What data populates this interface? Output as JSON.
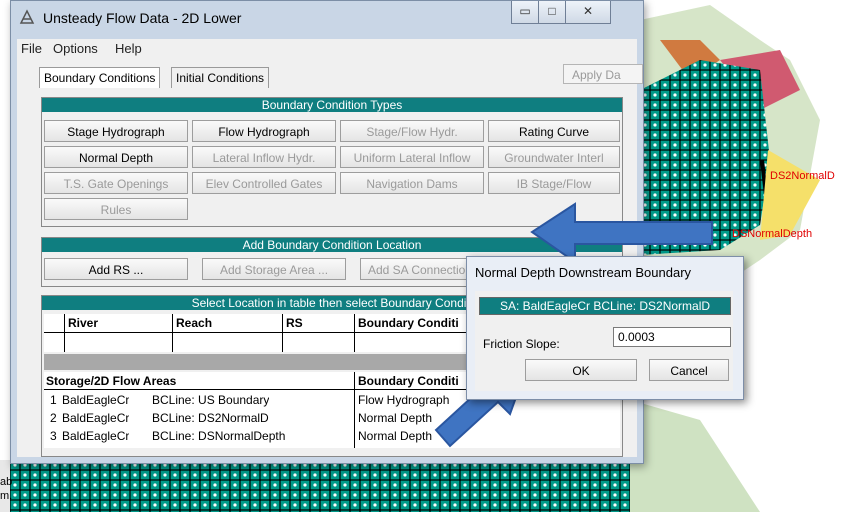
{
  "window": {
    "title": "Unsteady Flow Data - 2D Lower",
    "min_glyph": "▭",
    "max_glyph": "□",
    "close_glyph": "✕"
  },
  "menu": {
    "file": "File",
    "options": "Options",
    "help": "Help"
  },
  "tabs": {
    "boundary": "Boundary Conditions",
    "initial": "Initial Conditions"
  },
  "apply_label": "Apply Da",
  "bc_types": {
    "header": "Boundary Condition Types",
    "stage_hydrograph": "Stage Hydrograph",
    "flow_hydrograph": "Flow Hydrograph",
    "stage_flow_hydr": "Stage/Flow Hydr.",
    "rating_curve": "Rating Curve",
    "normal_depth": "Normal Depth",
    "lateral_inflow": "Lateral Inflow Hydr.",
    "uniform_lateral": "Uniform Lateral Inflow",
    "groundwater": "Groundwater Interl",
    "ts_gate": "T.S. Gate Openings",
    "elev_gates": "Elev Controlled Gates",
    "nav_dams": "Navigation Dams",
    "ib_stage_flow": "IB Stage/Flow",
    "rules": "Rules"
  },
  "add_location": {
    "header": "Add Boundary Condition Location",
    "add_rs": "Add RS ...",
    "add_storage": "Add Storage Area ...",
    "add_sa_conn": "Add SA Connection"
  },
  "table": {
    "header": "Select Location in table then select Boundary Conditi",
    "cols": {
      "river": "River",
      "reach": "Reach",
      "rs": "RS",
      "bc": "Boundary Conditi"
    },
    "sa_section": "Storage/2D Flow Areas",
    "sa_bc_col": "Boundary Conditi",
    "rows": [
      {
        "num": "1",
        "area": "BaldEagleCr",
        "line": "BCLine: US Boundary",
        "bc": "Flow Hydrograph"
      },
      {
        "num": "2",
        "area": "BaldEagleCr",
        "line": "BCLine: DS2NormalD",
        "bc": "Normal Depth"
      },
      {
        "num": "3",
        "area": "BaldEagleCr",
        "line": "BCLine: DSNormalDepth",
        "bc": "Normal Depth"
      }
    ]
  },
  "dialog": {
    "title": "Normal Depth Downstream Boundary",
    "header": "SA: BaldEagleCr BCLine: DS2NormalD",
    "friction_label": "Friction Slope:",
    "friction_value": "0.0003",
    "ok": "OK",
    "cancel": "Cancel"
  },
  "map_labels": {
    "ds2": "DS2NormalD",
    "ds": "DSNormalDepth",
    "cut_top": "ab",
    "cut_bottom": "m."
  },
  "colors": {
    "teal_header": "#0f7e80",
    "mesh_green": "#009a8a",
    "arrow_blue": "#3f74c2",
    "bc_label_red": "#e00000"
  }
}
